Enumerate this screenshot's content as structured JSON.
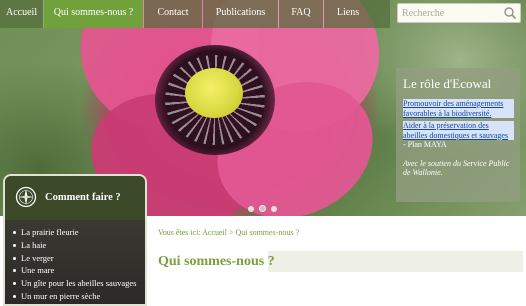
{
  "nav": {
    "items": [
      {
        "label": "Accueil"
      },
      {
        "label": "Qui sommes-nous ?"
      },
      {
        "label": "Contact"
      },
      {
        "label": "Publications"
      },
      {
        "label": "FAQ"
      },
      {
        "label": "Liens"
      }
    ],
    "active_index": 1
  },
  "search": {
    "placeholder": "Recherche",
    "icon": "search-icon"
  },
  "role_panel": {
    "title": "Le rôle d'Ecowal",
    "link1": "Promouvoir des aménagements favorables à la biodiversité.",
    "link2": "Aider à la préservation des abeilles domestiques et sauvages",
    "link2_suffix": "- Plan MAYA",
    "support": "Avec le soutien du Service Public de Wallonie."
  },
  "slider": {
    "dots": 3,
    "active_dot": 2
  },
  "sidebar": {
    "title": "Comment faire ?",
    "icon": "compass-icon",
    "items": [
      {
        "label": "La prairie fleurie"
      },
      {
        "label": "La haie"
      },
      {
        "label": "Le verger"
      },
      {
        "label": "Une mare"
      },
      {
        "label": "Un gîte pour les abeilles sauvages"
      },
      {
        "label": "Un mur en pierre sèche"
      }
    ]
  },
  "breadcrumb": {
    "prefix": "Vous êtes ici: ",
    "home": "Accueil",
    "sep": " > ",
    "current": "Qui sommes-nous ?"
  },
  "page": {
    "title": "Qui sommes-nous ?"
  },
  "colors": {
    "nav_active": "#70a13a",
    "accent_green": "#7aa23a",
    "link_blue": "#1546a8"
  }
}
